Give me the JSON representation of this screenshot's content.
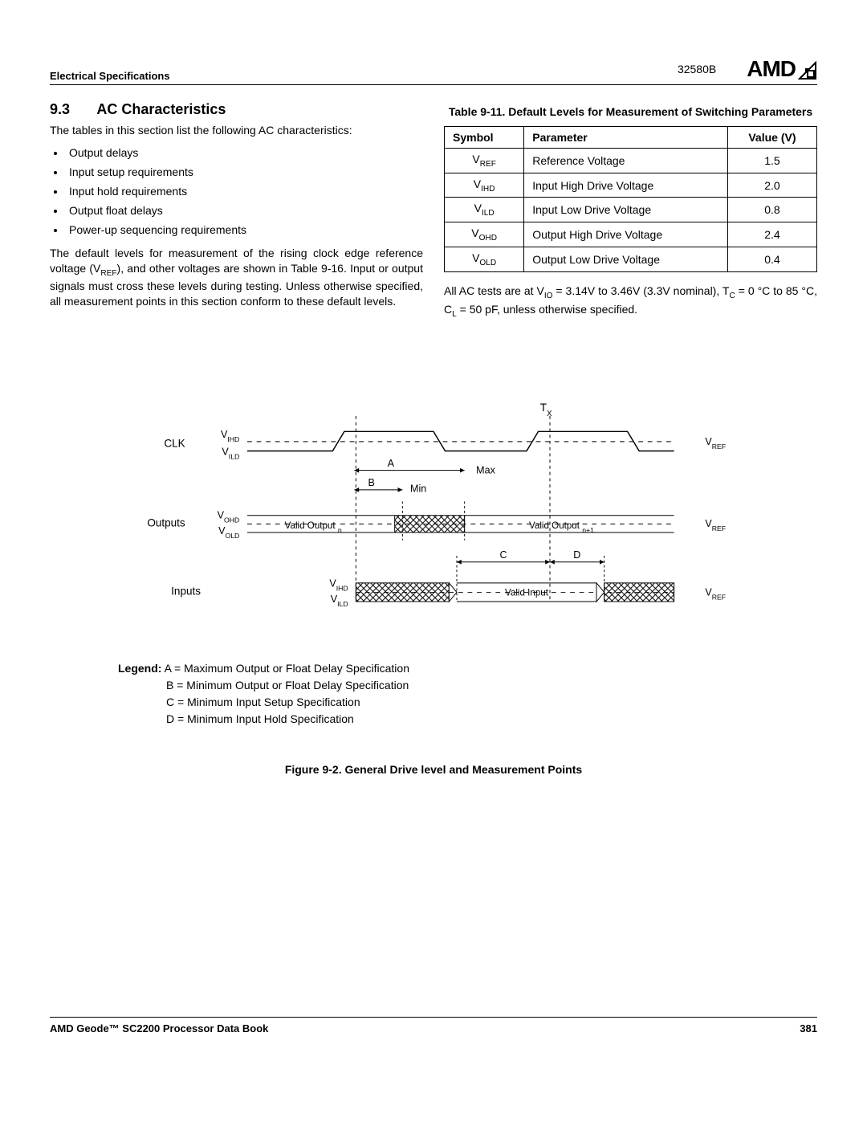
{
  "header": {
    "left": "Electrical Specifications",
    "docnum": "32580B",
    "logo": "AMD"
  },
  "section": {
    "number": "9.3",
    "title": "AC Characteristics",
    "intro": "The tables in this section list the following AC characteristics:",
    "bullets": [
      "Output delays",
      "Input setup requirements",
      "Input hold requirements",
      "Output float delays",
      "Power-up sequencing requirements"
    ],
    "para2a": "The default levels for measurement of the rising clock edge reference voltage (V",
    "para2b": "), and other voltages are shown in Table 9-16. Input or output signals must cross these levels during testing. Unless otherwise specified, all measurement points in this section conform to these default levels.",
    "vref_sub": "REF"
  },
  "table": {
    "caption": "Table 9-11.  Default Levels for Measurement of Switching Parameters",
    "headers": {
      "c1": "Symbol",
      "c2": "Parameter",
      "c3": "Value (V)"
    },
    "rows": [
      {
        "sym": "V",
        "sub": "REF",
        "param": "Reference Voltage",
        "val": "1.5"
      },
      {
        "sym": "V",
        "sub": "IHD",
        "param": "Input High Drive Voltage",
        "val": "2.0"
      },
      {
        "sym": "V",
        "sub": "ILD",
        "param": "Input Low Drive Voltage",
        "val": "0.8"
      },
      {
        "sym": "V",
        "sub": "OHD",
        "param": "Output High Drive Voltage",
        "val": "2.4"
      },
      {
        "sym": "V",
        "sub": "OLD",
        "param": "Output Low Drive Voltage",
        "val": "0.4"
      }
    ],
    "note_a": "All AC tests are at V",
    "note_vio_sub": "IO",
    "note_b": " = 3.14V to 3.46V (3.3V nominal), T",
    "note_tc_sub": "C",
    "note_c": " = 0 °C to 85 °C, C",
    "note_cl_sub": "L",
    "note_d": " = 50 pF, unless otherwise specified."
  },
  "diagram": {
    "tx": "T",
    "tx_sub": "X",
    "clk": "CLK",
    "vihd": "V",
    "vihd_sub": "IHD",
    "vild": "V",
    "vild_sub": "ILD",
    "vref": "V",
    "vref_sub": "REF",
    "a": "A",
    "max": "Max",
    "b": "B",
    "min": "Min",
    "outputs": "Outputs",
    "vohd": "V",
    "vohd_sub": "OHD",
    "vold": "V",
    "vold_sub": "OLD",
    "valid_out_n": "Valid Output ",
    "valid_out_n_sub": "n",
    "valid_out_n1": "Valid Output ",
    "valid_out_n1_sub": "n+1",
    "c": "C",
    "d": "D",
    "inputs": "Inputs",
    "valid_input": "Valid Input"
  },
  "legend": {
    "label": "Legend:",
    "a": "A = Maximum Output or Float Delay Specification",
    "b": "B = Minimum Output or Float Delay Specification",
    "c": "C = Minimum Input Setup Specification",
    "d": "D = Minimum Input Hold Specification"
  },
  "figure_caption": "Figure 9-2.  General Drive level and Measurement Points",
  "footer": {
    "left": "AMD Geode™ SC2200  Processor Data Book",
    "right": "381"
  }
}
